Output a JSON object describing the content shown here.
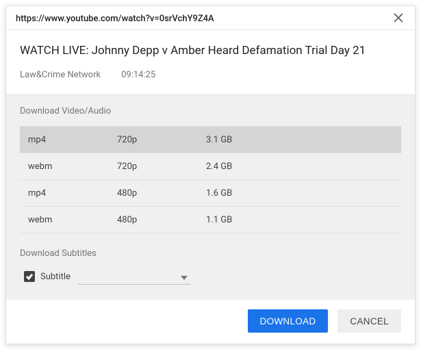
{
  "url": "https://www.youtube.com/watch?v=0srVchY9Z4A",
  "video": {
    "title": "WATCH LIVE: Johnny Depp v Amber Heard Defamation Trial Day 21",
    "channel": "Law&Crime Network",
    "duration": "09:14:25"
  },
  "download_section": {
    "heading": "Download Video/Audio",
    "formats": [
      {
        "format": "mp4",
        "quality": "720p",
        "size": "3.1 GB",
        "selected": true
      },
      {
        "format": "webm",
        "quality": "720p",
        "size": "2.4 GB",
        "selected": false
      },
      {
        "format": "mp4",
        "quality": "480p",
        "size": "1.6 GB",
        "selected": false
      },
      {
        "format": "webm",
        "quality": "480p",
        "size": "1.1 GB",
        "selected": false
      }
    ]
  },
  "subtitle_section": {
    "heading": "Download Subtitles",
    "checkbox_label": "Subtitle",
    "checked": true
  },
  "footer": {
    "download_label": "DOWNLOAD",
    "cancel_label": "CANCEL"
  }
}
